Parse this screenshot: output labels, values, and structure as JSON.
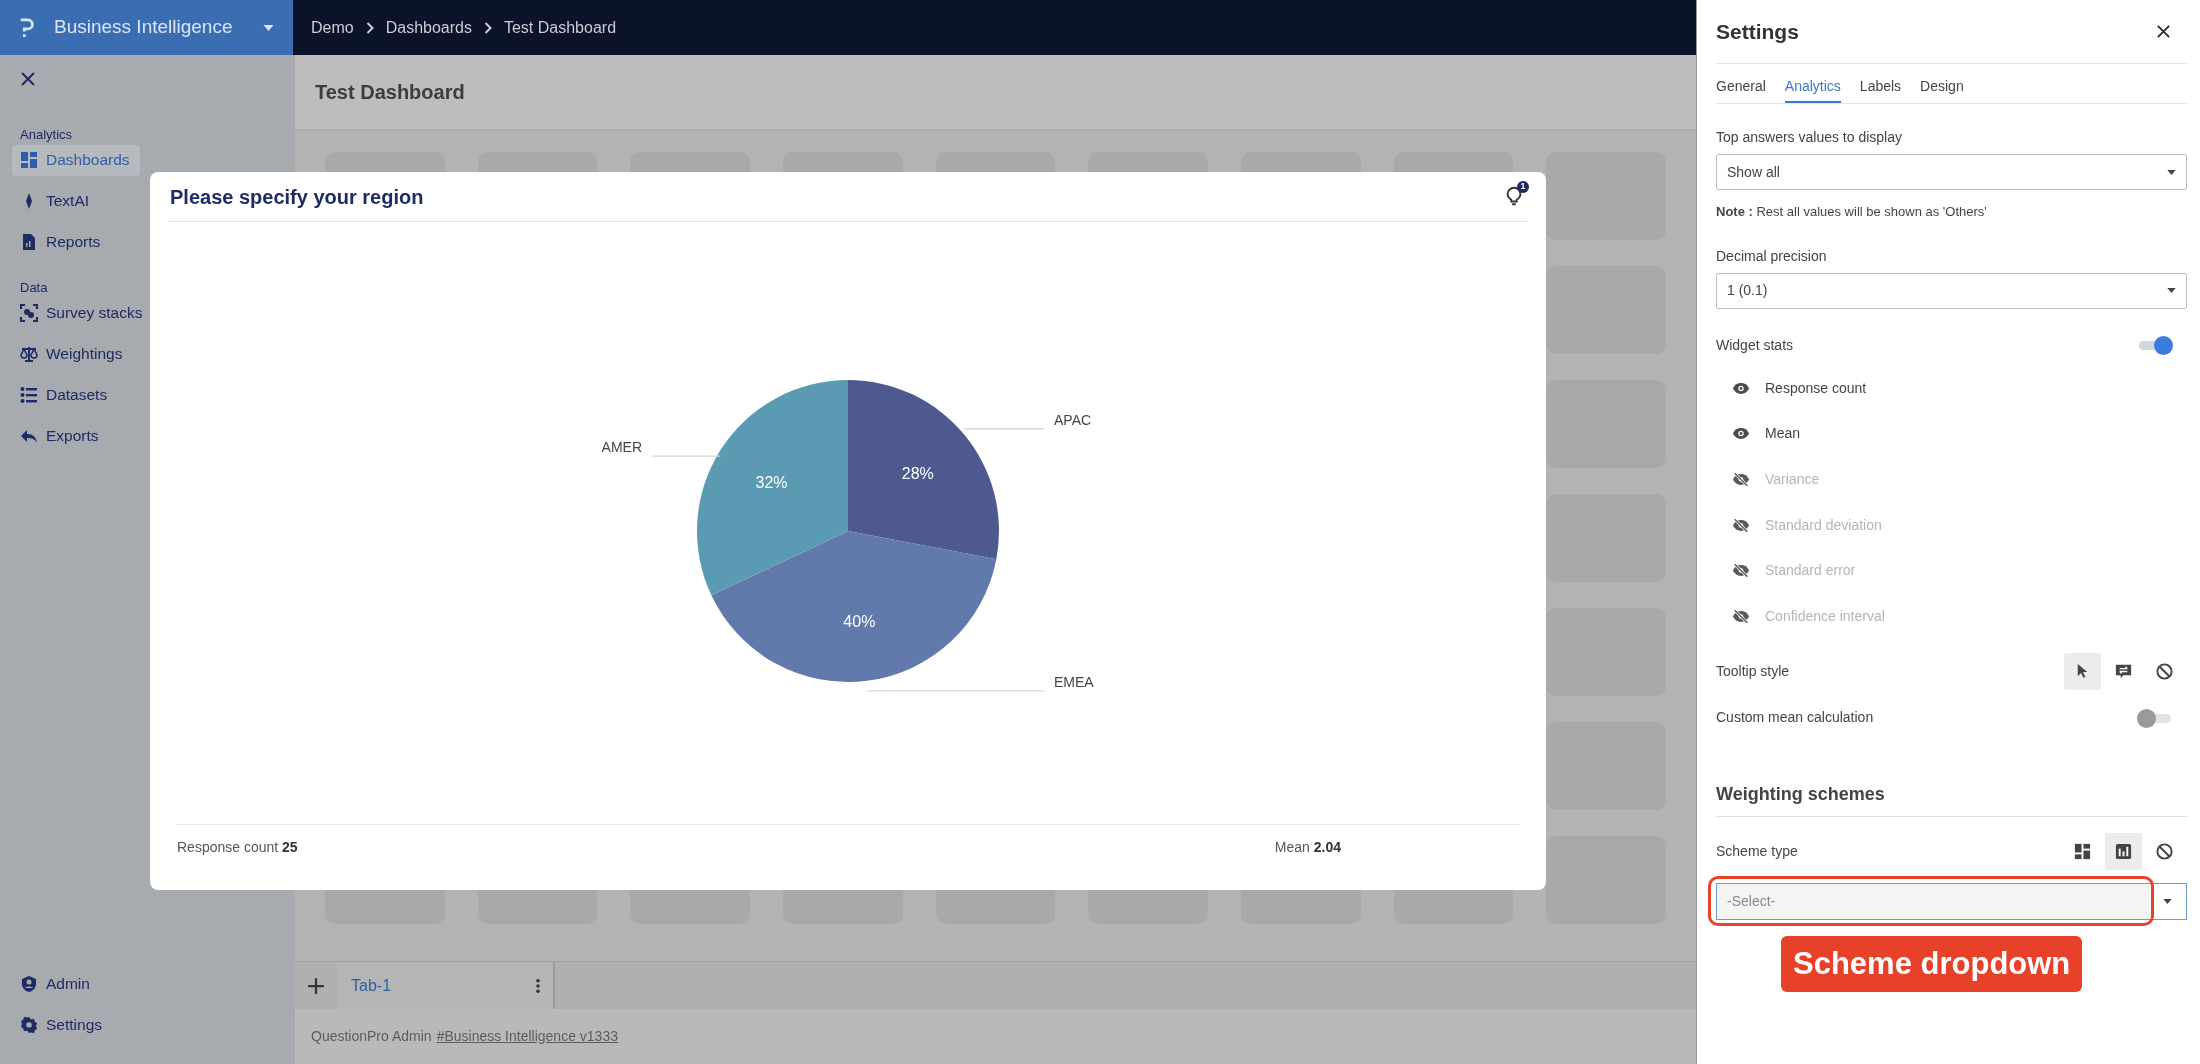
{
  "app": {
    "title": "Business Intelligence"
  },
  "breadcrumb": [
    "Demo",
    "Dashboards",
    "Test Dashboard"
  ],
  "sidebar": {
    "sections": [
      {
        "label": "Analytics",
        "items": [
          {
            "label": "Dashboards",
            "selected": true
          },
          {
            "label": "TextAI",
            "selected": false
          },
          {
            "label": "Reports",
            "selected": false
          }
        ]
      },
      {
        "label": "Data",
        "items": [
          {
            "label": "Survey stacks",
            "selected": false
          },
          {
            "label": "Weightings",
            "selected": false
          },
          {
            "label": "Datasets",
            "selected": false
          },
          {
            "label": "Exports",
            "selected": false
          }
        ]
      }
    ],
    "footer_items": [
      {
        "label": "Admin",
        "selected": false
      },
      {
        "label": "Settings",
        "selected": false
      }
    ]
  },
  "page_title": "Test Dashboard",
  "widget": {
    "title": "Please specify your region",
    "badge": "1",
    "chart_data": {
      "type": "pie",
      "categories": [
        "APAC",
        "EMEA",
        "AMER"
      ],
      "values": [
        28,
        40,
        32
      ],
      "colors": [
        "#4e5a8f",
        "#6179ab",
        "#5a9bb3"
      ],
      "data_labels": true,
      "value_labels": [
        "28%",
        "40%",
        "32%"
      ]
    },
    "stats": [
      {
        "label": "Response count",
        "value": "25"
      },
      {
        "label": "Mean",
        "value": "2.04"
      }
    ]
  },
  "dashboard_tabs": [
    {
      "label": "Tab-1",
      "selected": true
    }
  ],
  "footer": {
    "text": "QuestionPro Admin",
    "link": "#Business Intelligence v1333"
  },
  "settings": {
    "title": "Settings",
    "tabs": [
      {
        "label": "General",
        "selected": false
      },
      {
        "label": "Analytics",
        "selected": true
      },
      {
        "label": "Labels",
        "selected": false
      },
      {
        "label": "Design",
        "selected": false
      }
    ],
    "top_answers": {
      "label": "Top answers values to display",
      "value": "Show all"
    },
    "note": "**Note :** Rest all values will be shown as 'Others'",
    "decimal_precision": {
      "label": "Decimal precision",
      "value": "1 (0.1)"
    },
    "widget_stats": {
      "label": "Widget stats",
      "on": true,
      "items": [
        {
          "label": "Response count",
          "visible": true
        },
        {
          "label": "Mean",
          "visible": true
        },
        {
          "label": "Variance",
          "visible": false
        },
        {
          "label": "Standard deviation",
          "visible": false
        },
        {
          "label": "Standard error",
          "visible": false
        },
        {
          "label": "Confidence interval",
          "visible": false
        }
      ]
    },
    "tooltip_style": {
      "label": "Tooltip style",
      "options": [
        {
          "kind": "pointer",
          "selected": true
        },
        {
          "kind": "message",
          "selected": false
        },
        {
          "kind": "none",
          "selected": false
        }
      ]
    },
    "custom_mean": {
      "label": "Custom mean calculation",
      "on": false
    },
    "weighting_schemes": {
      "heading": "Weighting schemes",
      "scheme_type": {
        "label": "Scheme type",
        "options": [
          {
            "kind": "grid",
            "selected": false
          },
          {
            "kind": "bars",
            "selected": true
          },
          {
            "kind": "none",
            "selected": false
          }
        ]
      },
      "select": {
        "placeholder": "-Select-"
      }
    }
  },
  "annotation": {
    "label": "Scheme dropdown"
  }
}
